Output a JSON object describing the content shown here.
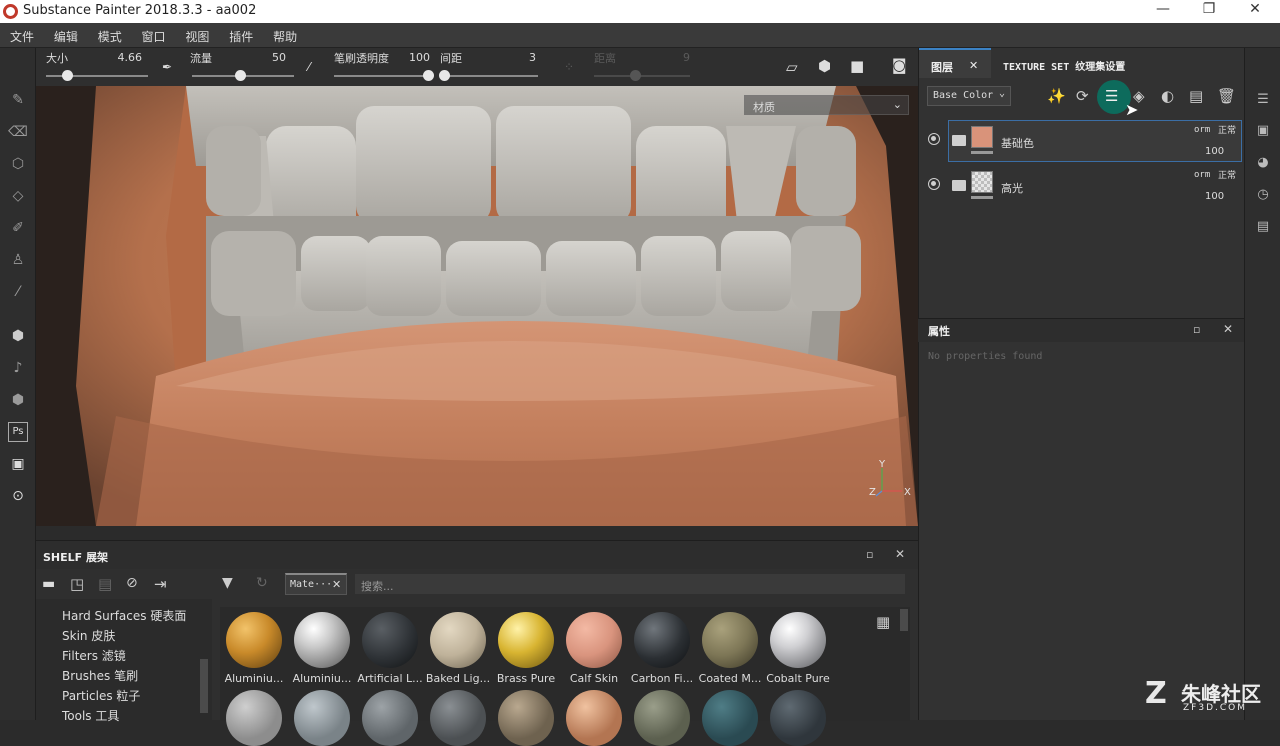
{
  "window": {
    "title": "Substance Painter 2018.3.3 - aa002",
    "min": "—",
    "max": "❐",
    "close": "✕"
  },
  "menu": [
    "文件",
    "编辑",
    "模式",
    "窗口",
    "视图",
    "插件",
    "帮助"
  ],
  "toolbar": {
    "size_label": "大小",
    "size_value": "4.66",
    "flow_label": "流量",
    "flow_value": "50",
    "opacity_label": "笔刷透明度",
    "opacity_value": "100",
    "spacing_label": "间距",
    "spacing_value": "3",
    "distance_label": "距离",
    "distance_value": "9"
  },
  "viewport": {
    "material_select": "材质",
    "axis_y": "Y",
    "axis_z": "Z",
    "axis_x": "X"
  },
  "layers_panel": {
    "tab_layers": "图层",
    "tab_close": "✕",
    "tab_texture_set": "TEXTURE SET 纹理集设置",
    "channel_select": "Base Color",
    "layers": [
      {
        "name": "基础色",
        "blend": "orm",
        "mode": "正常",
        "opacity": "100",
        "thumb_color": "#d9937a"
      },
      {
        "name": "高光",
        "blend": "orm",
        "mode": "正常",
        "opacity": "100",
        "thumb_color": "checker"
      }
    ]
  },
  "properties": {
    "title": "属性",
    "empty_text": "No properties found"
  },
  "shelf": {
    "title": "SHELF 展架",
    "categories": [
      "Hard Surfaces 硬表面",
      "Skin 皮肤",
      "Filters 滤镜",
      "Brushes 笔刷",
      "Particles 粒子",
      "Tools 工具"
    ],
    "tag": "Mate···",
    "search_placeholder": "搜索...",
    "materials": [
      {
        "name": "Aluminiu...",
        "color": "#c98a2a"
      },
      {
        "name": "Aluminiu...",
        "color": "#c8c8c8"
      },
      {
        "name": "Artificial L...",
        "color": "#2e3236"
      },
      {
        "name": "Baked Lig...",
        "color": "#bfb29a"
      },
      {
        "name": "Brass Pure",
        "color": "#d8b431"
      },
      {
        "name": "Calf Skin",
        "color": "#d9947e"
      },
      {
        "name": "Carbon Fi...",
        "color": "#2b2f33"
      },
      {
        "name": "Coated M...",
        "color": "#7d7656"
      },
      {
        "name": "Cobalt Pure",
        "color": "#cfcfd2"
      }
    ]
  },
  "watermark": {
    "brand": "朱峰社区",
    "site": "ZF3D.COM"
  }
}
